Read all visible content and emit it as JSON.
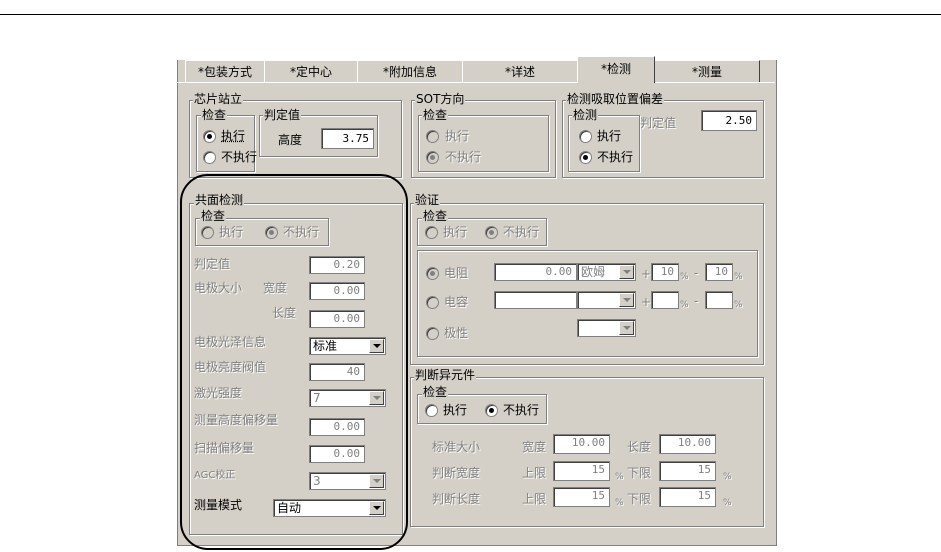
{
  "tabs": [
    "*包装方式",
    "*定中心",
    "*附加信息",
    "*详述",
    "*检测",
    "*测量"
  ],
  "chip_stand": {
    "title": "芯片站立",
    "check_title": "检查",
    "exec": "执行",
    "noexec": "不执行",
    "selected": "exec",
    "judge_title": "判定值",
    "height_label": "高度",
    "height_value": "3.75"
  },
  "sot": {
    "title": "SOT方向",
    "check_title": "检查",
    "exec": "执行",
    "noexec": "不执行",
    "selected": "noexec"
  },
  "pickup": {
    "title": "检测吸取位置偏差",
    "check_title": "检测",
    "exec": "执行",
    "noexec": "不执行",
    "selected": "noexec",
    "judge_label": "判定值",
    "judge_value": "2.50"
  },
  "coplanar": {
    "title": "共面检测",
    "check_title": "检查",
    "exec": "执行",
    "noexec": "不执行",
    "selected": "noexec",
    "judge_label": "判定值",
    "judge_value": "0.20",
    "electrode_size_label": "电极大小",
    "width_label": "宽度",
    "width_value": "0.00",
    "length_label": "长度",
    "length_value": "0.00",
    "gloss_label": "电极光泽信息",
    "gloss_value": "标准",
    "brightness_label": "电极亮度阀值",
    "brightness_value": "40",
    "laser_label": "激光强度",
    "laser_value": "7",
    "height_offset_label": "测量高度偏移量",
    "height_offset_value": "0.00",
    "scan_offset_label": "扫描偏移量",
    "scan_offset_value": "0.00",
    "agc_label": "AGC校正",
    "agc_value": "3",
    "mode_label": "测量模式",
    "mode_value": "自动"
  },
  "verify": {
    "title": "验证",
    "check_title": "检查",
    "exec": "执行",
    "noexec": "不执行",
    "selected": "noexec",
    "resistance_label": "电阻",
    "resistance_value": "0.00",
    "resistance_unit": "欧姆",
    "plus": "+",
    "minus": "-",
    "pct": "%",
    "res_plus_value": "10",
    "res_minus_value": "10",
    "capacitance_label": "电容",
    "polarity_label": "极性"
  },
  "abnormal": {
    "title": "判断异元件",
    "check_title": "检查",
    "exec": "执行",
    "noexec": "不执行",
    "selected": "noexec",
    "std_size_label": "标准大小",
    "width_label": "宽度",
    "width_value": "10.00",
    "length_label": "长度",
    "length_value": "10.00",
    "judge_width_label": "判断宽度",
    "judge_length_label": "判断长度",
    "upper_label": "上限",
    "lower_label": "下限",
    "pct": "%",
    "jw_upper": "15",
    "jw_lower": "15",
    "jl_upper": "15",
    "jl_lower": "15"
  }
}
